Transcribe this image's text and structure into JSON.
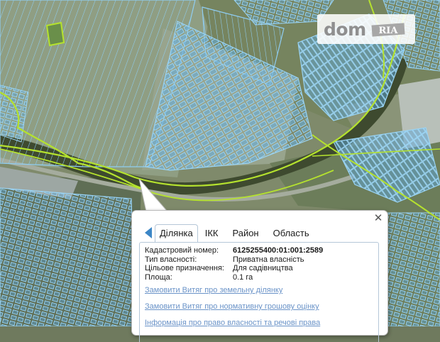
{
  "watermark": {
    "brand_text": "dom",
    "brand_badge": "RIA"
  },
  "popup": {
    "tabs": [
      "Ділянка",
      "ІКК",
      "Район",
      "Область"
    ],
    "active_tab": 0,
    "properties": [
      {
        "label": "Кадастровий номер:",
        "value": "6125255400:01:001:2589"
      },
      {
        "label": "Тип власності:",
        "value": "Приватна власність"
      },
      {
        "label": "Цільове призначення:",
        "value": "Для садівництва"
      },
      {
        "label": "Площа:",
        "value": "0.1 га"
      }
    ],
    "links": [
      "Замовити Витяг про земельну ділянку",
      "Замовити Витяг про нормативну грошову оцінку",
      "Інформація про право власності та речові права"
    ]
  },
  "colors": {
    "parcel_stroke": "#86c6ee",
    "parcel_fill": "#5fa9db",
    "boundary": "#b5e22e",
    "link": "#6a93c8",
    "tab_arrow": "#3c86c6"
  },
  "icons": [
    "chevron-left-icon",
    "close-icon"
  ]
}
